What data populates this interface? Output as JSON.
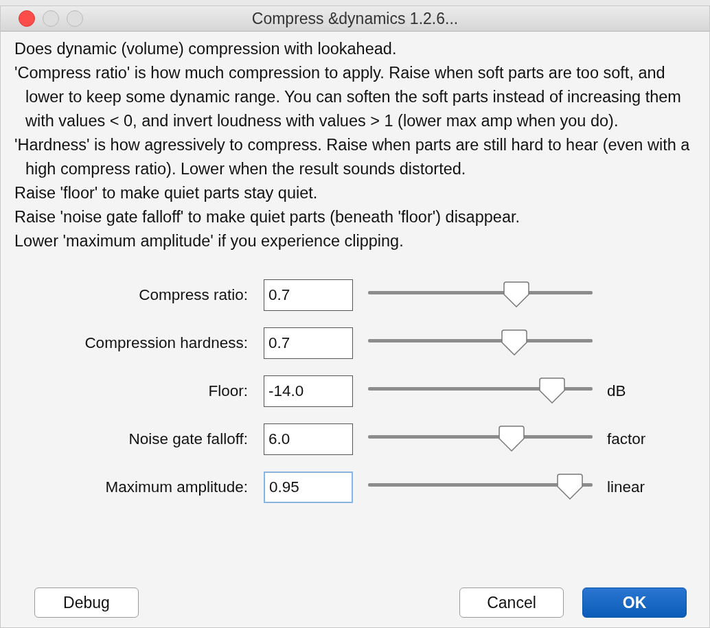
{
  "window": {
    "title": "Compress &dynamics 1.2.6..."
  },
  "description": [
    "Does dynamic (volume) compression with lookahead.",
    "'Compress ratio' is how much compression to apply. Raise when soft parts are too soft, and lower to keep some dynamic range. You can soften the soft parts instead of increasing them with values < 0, and invert loudness with values > 1 (lower max amp when you do).",
    "'Hardness' is how agressively to compress. Raise when parts are still hard to hear (even with a high compress ratio). Lower when the result sounds distorted.",
    "Raise 'floor' to make quiet parts stay quiet.",
    "Raise 'noise gate falloff' to make quiet parts (beneath 'floor') disappear.",
    "Lower 'maximum amplitude' if you experience clipping."
  ],
  "controls": [
    {
      "label": "Compress ratio:",
      "value": "0.7",
      "level": 0.66,
      "focused": false
    },
    {
      "label": "Compression hardness:",
      "value": "0.7",
      "level": 0.65,
      "focused": false
    },
    {
      "label": "Floor:",
      "value": "-14.0",
      "level": 0.82,
      "unit": "dB",
      "focused": false
    },
    {
      "label": "Noise gate falloff:",
      "value": "6.0",
      "level": 0.64,
      "unit": "factor",
      "focused": false
    },
    {
      "label": "Maximum amplitude:",
      "value": "0.95",
      "level": 0.9,
      "unit": "linear",
      "focused": true
    }
  ],
  "buttons": [
    {
      "label": "Debug",
      "default": false
    },
    {
      "label": "Cancel",
      "default": false
    },
    {
      "label": "OK",
      "default": true
    }
  ]
}
